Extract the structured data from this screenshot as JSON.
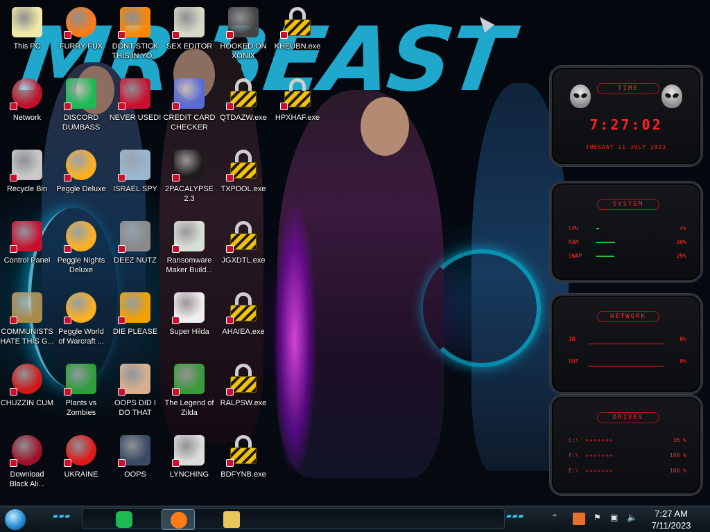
{
  "desktop": {
    "icons": [
      {
        "label": "This PC",
        "icon": "this-pc-icon",
        "color": "#f1e9a8"
      },
      {
        "label": "FURRY FUX",
        "icon": "firefox-icon",
        "color": "#ff7a18"
      },
      {
        "label": "DONT STICK THIS IN YO...",
        "icon": "vlc-icon",
        "color": "#ff8800"
      },
      {
        "label": "SEX EDITOR",
        "icon": "hex-editor-icon",
        "color": "#d8d8c8"
      },
      {
        "label": "HOOKED ON XONIX",
        "icon": "xonix-game-icon",
        "color": "#444444"
      },
      {
        "label": "KHEUBN.exe",
        "icon": "lock-icon",
        "color": "#f2c200"
      },
      {
        "label": "Network",
        "icon": "network-icon",
        "color": "#c0102a"
      },
      {
        "label": "DISCORD DUMBASS",
        "icon": "spotify-icon",
        "color": "#1db954"
      },
      {
        "label": "NEVER USED!",
        "icon": "dev-cpp-icon",
        "color": "#c8102e"
      },
      {
        "label": "CREDIT CARD CHECKER",
        "icon": "credit-card-icon",
        "color": "#5a6bd8"
      },
      {
        "label": "QTDAZW.exe",
        "icon": "lock-icon",
        "color": "#f2c200"
      },
      {
        "label": "HPXHAF.exe",
        "icon": "lock-icon",
        "color": "#f2c200"
      },
      {
        "label": "Recycle Bin",
        "icon": "recycle-bin-icon",
        "color": "#c8c8c8"
      },
      {
        "label": "Peggle Deluxe",
        "icon": "peggle-icon",
        "color": "#ffb020"
      },
      {
        "label": "ISRAEL SPY",
        "icon": "spy-icon",
        "color": "#9ab7d0"
      },
      {
        "label": "2PACALYPSE 2.3",
        "icon": "terminal-icon",
        "color": "#1c1c1c"
      },
      {
        "label": "TXPDOL.exe",
        "icon": "lock-icon",
        "color": "#f2c200"
      },
      {
        "label": "Control Panel",
        "icon": "control-panel-icon",
        "color": "#c8102e"
      },
      {
        "label": "Peggle Nights Deluxe",
        "icon": "peggle-nights-icon",
        "color": "#ffb020"
      },
      {
        "label": "DEEZ NUTZ",
        "icon": "stacked-windows-icon",
        "color": "#8a8a8a"
      },
      {
        "label": "Ransomware Maker Build...",
        "icon": "ransomware-builder-icon",
        "color": "#d7e0d7"
      },
      {
        "label": "JGXDTL.exe",
        "icon": "lock-icon",
        "color": "#f2c200"
      },
      {
        "label": "COMMUNISTS HATE THIS G...",
        "icon": "money-bag-icon",
        "color": "#a88a4a"
      },
      {
        "label": "Peggle World of Warcraft ...",
        "icon": "peggle-wow-icon",
        "color": "#ffb020"
      },
      {
        "label": "DIE PLEASE",
        "icon": "de-icon",
        "color": "#f4a000"
      },
      {
        "label": "Super Hilda",
        "icon": "pixel-face-icon",
        "color": "#eeeeee"
      },
      {
        "label": "AHAIEA.exe",
        "icon": "lock-icon",
        "color": "#f2c200"
      },
      {
        "label": "CHUZZIN CUM",
        "icon": "chuzzle-icon",
        "color": "#d01818"
      },
      {
        "label": "Plants vs Zombies",
        "icon": "pvz-icon",
        "color": "#2e9d3a"
      },
      {
        "label": "OOPS DID I DO THAT",
        "icon": "portrait-icon",
        "color": "#d8b090"
      },
      {
        "label": "The Legend of Zilda",
        "icon": "zelda-icon",
        "color": "#3a9a3a"
      },
      {
        "label": "RALPSW.exe",
        "icon": "lock-icon",
        "color": "#f2c200"
      },
      {
        "label": "Download Black Ali...",
        "icon": "alien-disc-icon",
        "color": "#a0102a"
      },
      {
        "label": "UKRAINE",
        "icon": "radiation-icon",
        "color": "#e01818"
      },
      {
        "label": "OOPS",
        "icon": "document-icon",
        "color": "#3a4a66"
      },
      {
        "label": "LYNCHING",
        "icon": "noose-icon",
        "color": "#dddddd"
      },
      {
        "label": "BDFYNB.exe",
        "icon": "lock-icon",
        "color": "#f2c200"
      }
    ]
  },
  "wallpaper": {
    "text": "MR BEAST"
  },
  "widgets": {
    "time": {
      "title": "TIME",
      "clock": "7:27:02",
      "date": "TUESDAY 11 JULY 2023"
    },
    "system": {
      "title": "SYSTEM",
      "rows": [
        {
          "label": "CPU",
          "value": "4%",
          "level": 0.04
        },
        {
          "label": "RAM",
          "value": "30%",
          "level": 0.3
        },
        {
          "label": "SWAP",
          "value": "29%",
          "level": 0.29
        }
      ]
    },
    "network": {
      "title": "NETWORK",
      "rows": [
        {
          "label": "IN",
          "value": "0%"
        },
        {
          "label": "OUT",
          "value": "0%"
        }
      ]
    },
    "drives": {
      "title": "DRIVES",
      "rows": [
        {
          "label": "C:\\",
          "value": "36 %"
        },
        {
          "label": "F:\\",
          "value": "100 %"
        },
        {
          "label": "E:\\",
          "value": "100 %"
        }
      ]
    }
  },
  "taskbar": {
    "apps": [
      {
        "name": "spotify",
        "icon": "spotify-icon",
        "color": "#1db954"
      },
      {
        "name": "firefox",
        "icon": "firefox-icon",
        "color": "#ff7a18"
      },
      {
        "name": "file-explorer",
        "icon": "folder-icon",
        "color": "#e8c65a"
      }
    ],
    "tray": {
      "time": "7:27 AM",
      "date": "7/11/2023"
    }
  }
}
